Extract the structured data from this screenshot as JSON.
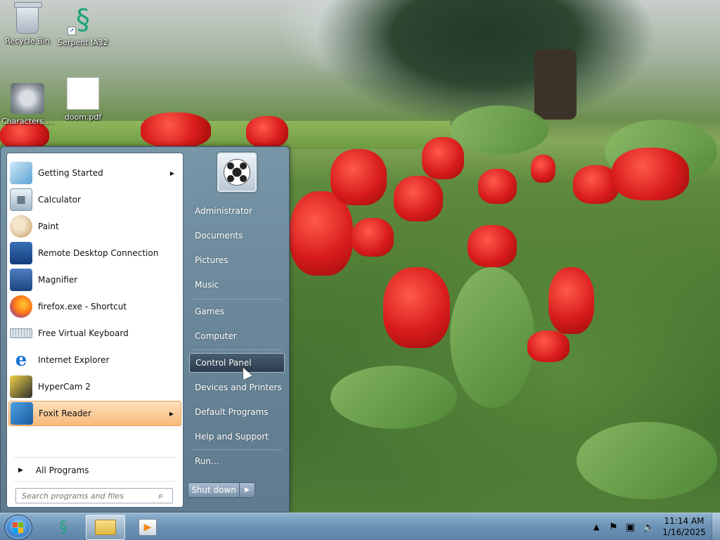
{
  "desktop": {
    "icons": [
      {
        "label": "Recycle Bin",
        "icon": "recycle-bin-icon"
      },
      {
        "label": "Serpent IA32",
        "icon": "serpent-icon"
      },
      {
        "label": "Characters....",
        "icon": "characters-icon"
      },
      {
        "label": "doom.pdf",
        "icon": "pdf-file-icon"
      }
    ]
  },
  "start_menu": {
    "programs": [
      {
        "label": "Getting Started",
        "icon": "getting-started-icon",
        "has_submenu": true
      },
      {
        "label": "Calculator",
        "icon": "calculator-icon"
      },
      {
        "label": "Paint",
        "icon": "paint-icon"
      },
      {
        "label": "Remote Desktop Connection",
        "icon": "remote-desktop-icon"
      },
      {
        "label": "Magnifier",
        "icon": "magnifier-icon"
      },
      {
        "label": "firefox.exe - Shortcut",
        "icon": "firefox-icon"
      },
      {
        "label": "Free Virtual Keyboard",
        "icon": "keyboard-icon"
      },
      {
        "label": "Internet Explorer",
        "icon": "internet-explorer-icon"
      },
      {
        "label": "HyperCam 2",
        "icon": "hypercam-icon"
      },
      {
        "label": "Foxit Reader",
        "icon": "foxit-reader-icon",
        "has_submenu": true,
        "highlighted": true
      }
    ],
    "all_programs": "All Programs",
    "search_placeholder": "Search programs and files",
    "user_avatar": "soccer-ball-avatar",
    "right_items": [
      {
        "label": "Administrator"
      },
      {
        "label": "Documents"
      },
      {
        "label": "Pictures"
      },
      {
        "label": "Music"
      },
      {
        "label": "Games"
      },
      {
        "label": "Computer"
      },
      {
        "label": "Control Panel",
        "highlighted": true
      },
      {
        "label": "Devices and Printers"
      },
      {
        "label": "Default Programs"
      },
      {
        "label": "Help and Support"
      },
      {
        "label": "Run..."
      }
    ],
    "shutdown_label": "Shut down"
  },
  "taskbar": {
    "pinned": [
      {
        "icon": "serpent-icon"
      },
      {
        "icon": "windows-explorer-icon",
        "active": true
      },
      {
        "icon": "media-player-icon"
      }
    ],
    "tray_icons": [
      "show-hidden-icons-icon",
      "action-center-flag-icon",
      "network-icon",
      "volume-icon"
    ],
    "time": "11:14 AM",
    "date": "1/16/2025"
  },
  "colors": {
    "menu_highlight": "#f9b979",
    "accent": "#3f86d0"
  }
}
